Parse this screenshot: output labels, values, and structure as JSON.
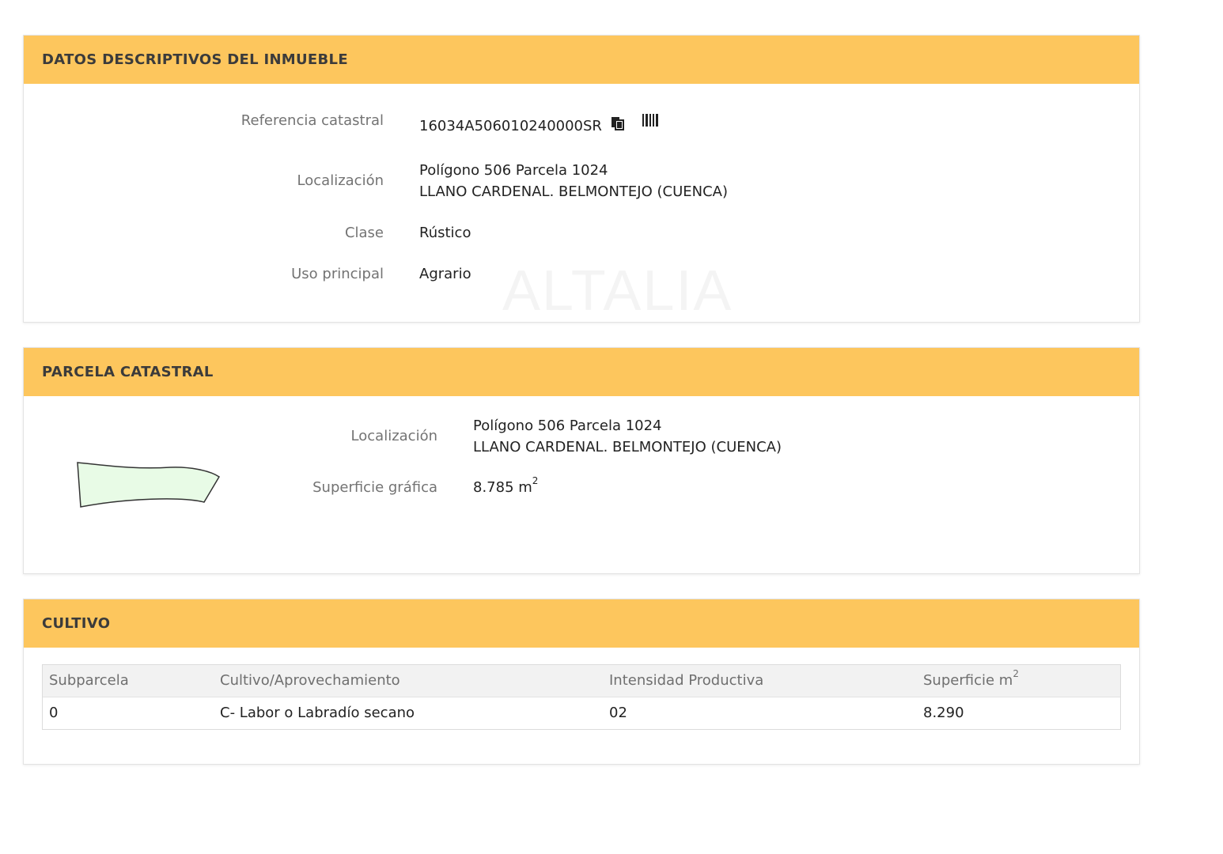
{
  "inmueble": {
    "header": "DATOS DESCRIPTIVOS DEL INMUEBLE",
    "referencia_label": "Referencia catastral",
    "referencia_value": "16034A506010240000SR",
    "localizacion_label": "Localización",
    "localizacion_line1": "Polígono 506 Parcela 1024",
    "localizacion_line2": "LLANO CARDENAL. BELMONTEJO (CUENCA)",
    "clase_label": "Clase",
    "clase_value": "Rústico",
    "uso_label": "Uso principal",
    "uso_value": "Agrario",
    "watermark": "ALTALIA"
  },
  "parcela": {
    "header": "PARCELA CATASTRAL",
    "localizacion_label": "Localización",
    "localizacion_line1": "Polígono 506 Parcela 1024",
    "localizacion_line2": "LLANO CARDENAL. BELMONTEJO (CUENCA)",
    "superficie_label": "Superficie gráfica",
    "superficie_value": "8.785 m",
    "superficie_exp": "2",
    "shape_fill": "#e8fbe6",
    "shape_stroke": "#333333"
  },
  "cultivo": {
    "header": "CULTIVO",
    "columns": [
      "Subparcela",
      "Cultivo/Aprovechamiento",
      "Intensidad Productiva",
      "Superficie m"
    ],
    "column_exp": "2",
    "rows": [
      [
        "0",
        "C- Labor o Labradío secano",
        "02",
        "8.290"
      ]
    ]
  },
  "colors": {
    "header_bg": "#fdc65d",
    "label": "#737373",
    "value": "#222222"
  },
  "icons": [
    "copy-icon",
    "barcode-icon"
  ]
}
